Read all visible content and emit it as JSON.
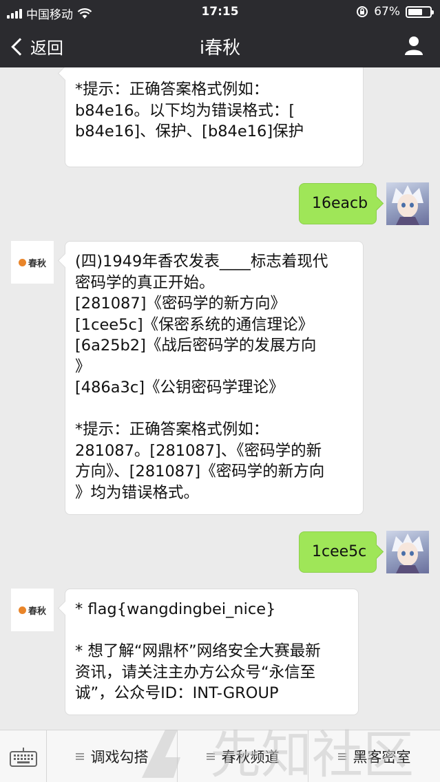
{
  "status_bar": {
    "carrier": "中国移动",
    "time": "17:15",
    "battery_percent": "67%",
    "battery_level": 0.67
  },
  "nav": {
    "back_label": "返回",
    "title": "i春秋"
  },
  "messages": [
    {
      "sender": "bot",
      "lines": [
        "*提示：正确答案格式例如：",
        "b84e16。以下均为错误格式：[",
        "b84e16]、保护、[b84e16]保护"
      ]
    },
    {
      "sender": "user",
      "text": "16eacb"
    },
    {
      "sender": "bot",
      "lines": [
        "(四)1949年香农发表____标志着现代",
        "密码学的真正开始。",
        "[281087]《密码学的新方向》",
        "[1cee5c]《保密系统的通信理论》",
        "[6a25b2]《战后密码学的发展方向",
        "》",
        "[486a3c]《公钥密码学理论》",
        "",
        "*提示：正确答案格式例如：",
        "281087。[281087]、《密码学的新",
        "方向》、[281087]《密码学的新方向",
        "》均为错误格式。"
      ]
    },
    {
      "sender": "user",
      "text": "1cee5c"
    },
    {
      "sender": "bot",
      "lines": [
        "* flag{wangdingbei_nice}",
        "",
        "* 想了解“网鼎杯”网络安全大赛最新",
        "资讯，请关注主办方公众号“永信至",
        "诚”，公众号ID：INT-GROUP"
      ]
    }
  ],
  "bot_logo_text": "春秋",
  "bottom_menu": {
    "items": [
      "调戏勾搭",
      "春秋频道",
      "黑客密室"
    ]
  },
  "watermark_text": "先知社区",
  "icons": {
    "back": "chevron-left-icon",
    "profile": "person-icon",
    "keyboard": "keyboard-icon",
    "menu": "hamburger-icon"
  }
}
